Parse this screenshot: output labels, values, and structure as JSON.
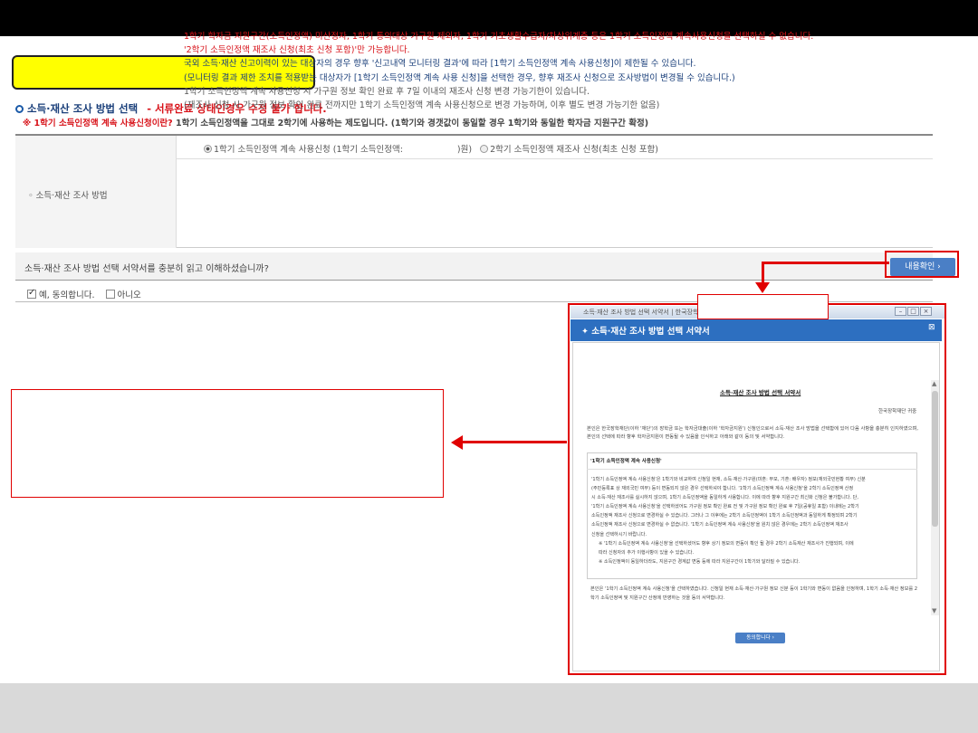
{
  "section": {
    "title": "소득·재산 조사 방법 선택",
    "warning": "- 서류완료 상태인경우 수정 불가 합니다."
  },
  "notice": {
    "question": "※ 1학기 소득인정액 계속 사용신청이란?",
    "answer": "1학기 소득인정액을 그대로 2학기에 사용하는 제도입니다. (1학기와 경갯값이 동일할 경우 1학기와 동일한 학자금 지원구간 확정)"
  },
  "form": {
    "label": "◦ 소득·재산 조사 방법",
    "option1": "1학기 소득인정액 계속 사용신청 (1학기 소득인정액:",
    "option1_suffix": ")원)",
    "option2": "2학기 소득인정액 재조사 신청(최초 신청 포함)",
    "lines": [
      "1학기 학자금 지원구간(소득인정액) 미산정자, 1학기 통의대상 가구원 제외자, 1학기 기초생활수급자/차상위계층 등은 1학기 소득인정액 계속사용신청을 선택하실 수 없습니다.",
      "'2학기 소득인정액 재조사 신청(최초 신청 포함)'만 가능합니다.",
      "국외 소득·재산 신고이력이 있는 대상자의 경우 향후 '신고내역 모니터링 결과'에 따라 [1학기 소득인정액 계속 사용신청]이 제한될 수 있습니다.",
      "(모니터링 결과 제한 조치를 적용받는 대상자가 [1학기 소득인정액 계속 사용 신청]을 선택한 경우, 향후 재조사 신청으로 조사방법이 변경될 수 있습니다.)",
      "1학기 소득인정액 계속 사용신청 시 가구원 정보 확인 완료 후 7일 이내의 재조사 신청 변경 가능기한이 있습니다.",
      "(재조사 신청 시 가구원 정보 확인 완료 전까지만 1학기 소득인정액 계속 사용신청으로 변경 가능하며, 이후 별도 변경 가능기한 없음)"
    ]
  },
  "consent": {
    "question": "소득·재산 조사 방법 선택 서약서를 충분히 읽고 이해하셨습니까?",
    "button": "내용확인 ›",
    "yes": "예, 동의합니다.",
    "no": "아니오"
  },
  "popup": {
    "window_title": "소득·재산 조사 방법 선택 서약서 | 한국장학재단",
    "header": "✦ 소득·재산 조사 방법 선택 서약서",
    "doc_title": "소득·재산 조사 방법 선택 서약서",
    "org": "한국장학재단 귀중",
    "intro": "본인은 한국장학재단(이하 '재단')의 장학금 또는 학자금대출(이하 '학자금지원') 신청인으로서 소득·재산 조사 방법을 선택함에 있어 다음 사항을 충분히 인지하였으며, 본인의 선택에 따라 향후 학자금지원이 변동될 수 있음을 인식하고 아래와 같이 동의 및 서약합니다.",
    "sec_head": "'1학기 소득인정액 계속 사용신청'",
    "sec_lines": [
      "'1학기 소득인정액 계속 사용신청'은 1학기와 비교하여 신청일 현재, 소득·재산·가구원(미혼: 부모, 기혼: 배우자) 정보(재외국민현황 여부) 신분",
      "(주민등록표 상 재외국민 여부) 등이 변동되지 않은 경우 선택하셔야 합니다. '1학기 소득인정액 계속 사용신청'을 2학기 소득인정액 산정",
      "시 소득·재산 재조사를 실시하지 않으며, 1학기 소득인정액을 동일하게 사용합니다. 이에 따라 향후 지원구간 최신화 신청은 불가합니다. 단,",
      "'1학기 소득인정액 계속 사용신청'을 선택하셨어도 가구원 정보 확인 완료 전 및 가구원 정보 확인 완료 후 7일(공휴일 포함) 이내에는 2학기",
      "소득인정액 재조사 신청으로 변경하실 수 있습니다. 그러나 그 이후에는 2학기 소득인정액이 1학기 소득인정액과 동일하게 확정되며 2학기",
      "소득인정액 재조사 신청으로 변경하실 수 없습니다. '1학기 소득인정액 계속 사용신청'을 원치 않은 경우에는 2학기 소득인정액 재조사",
      "신청을 선택하시기 바랍니다."
    ],
    "sec_notes": [
      "※ '1학기 소득인정액 계속 사용신청'을 선택하셨어도 향후 상기 정보의 변동이 확인 될 경우 2학기 소득재산 재조사가 진행되며, 이에",
      "따라 신청자의 추가 이행사항이 있을 수 있습니다.",
      "※ 소득인정액이 동일하더라도, 지원구간 경계값 변동 등에 따라 지원구간이 1학기와 달라질 수 있습니다."
    ],
    "footer": "본인은 '1학기 소득인정액 계속 사용신청'을 선택하였습니다. 신청일 현재 소득·재산·가구원 정보 신분 등이 1학기와 변동이 없음을 인정하며, 1학기 소득·재산 정보를 2학기 소득인정액 및 지원구간 산정에 반영하는 것을 동의 서약합니다.",
    "agree_button": "동의합니다 ›"
  },
  "colors": {
    "accent_red": "#e00000",
    "primary_blue": "#2d6fc0",
    "highlight_yellow": "#ffff00"
  }
}
